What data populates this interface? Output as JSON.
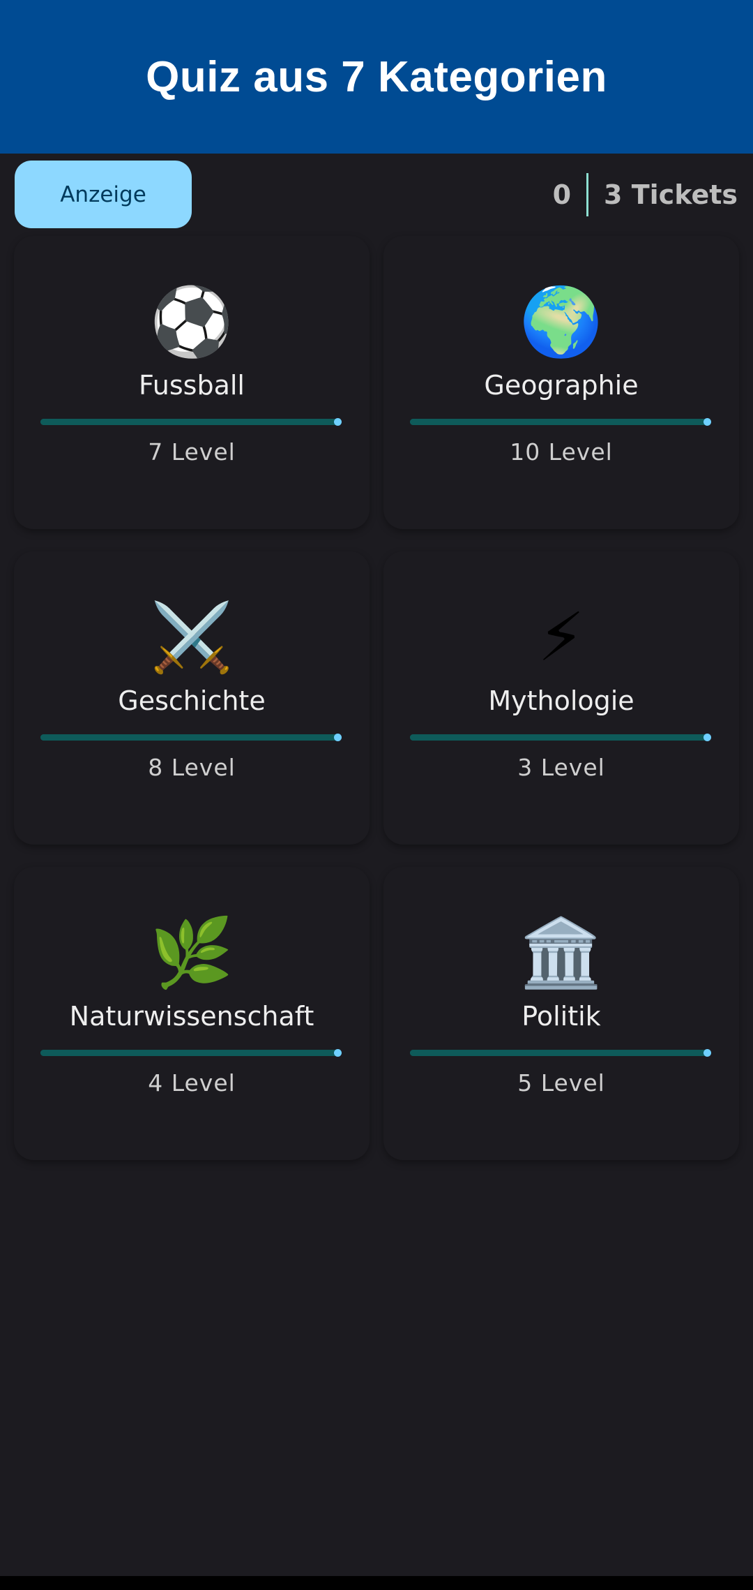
{
  "header": {
    "title": "Quiz aus 7 Kategorien",
    "background": "#004b93"
  },
  "topbar": {
    "ad_label": "Anzeige",
    "count": "0",
    "tickets": "3 Tickets"
  },
  "categories": [
    {
      "name": "Fussball",
      "levels": "7 Level",
      "icon": "soccer-ball-icon",
      "glyph": "⚽",
      "progress": 1.0
    },
    {
      "name": "Geographie",
      "levels": "10 Level",
      "icon": "globe-icon",
      "glyph": "🌍",
      "progress": 1.0
    },
    {
      "name": "Geschichte",
      "levels": "8 Level",
      "icon": "crossed-swords-icon",
      "glyph": "⚔️",
      "progress": 1.0
    },
    {
      "name": "Mythologie",
      "levels": "3 Level",
      "icon": "lightning-icon",
      "glyph": "⚡",
      "progress": 1.0
    },
    {
      "name": "Naturwissenschaft",
      "levels": "4 Level",
      "icon": "herb-icon",
      "glyph": "🌿",
      "progress": 1.0
    },
    {
      "name": "Politik",
      "levels": "5 Level",
      "icon": "classical-building-icon",
      "glyph": "🏛️",
      "progress": 1.0
    }
  ],
  "colors": {
    "background": "#1c1b20",
    "accent": "#8dd8ff",
    "progress_track": "#0e5b5a",
    "progress_dot": "#6fd0ff"
  }
}
